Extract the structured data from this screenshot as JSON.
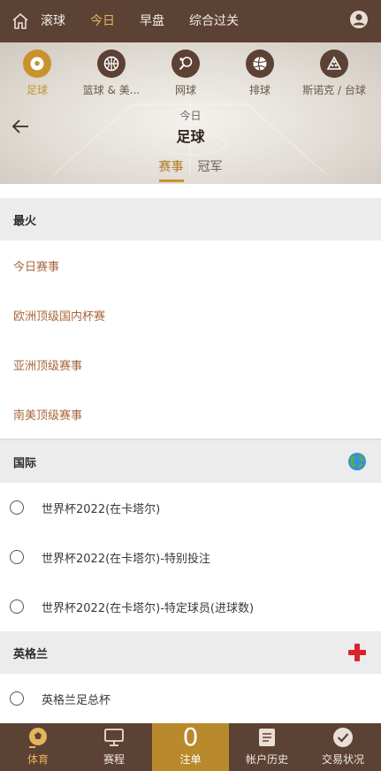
{
  "top_nav": {
    "tabs": [
      "滚球",
      "今日",
      "早盘",
      "综合过关"
    ],
    "active_tab": "今日",
    "active_color": "#e5b35a"
  },
  "sports": [
    {
      "label": "足球",
      "icon": "soccer-ball-icon",
      "active": true
    },
    {
      "label": "篮球 & 美...",
      "icon": "basketball-icon",
      "active": false
    },
    {
      "label": "网球",
      "icon": "tennis-icon",
      "active": false
    },
    {
      "label": "排球",
      "icon": "volleyball-icon",
      "active": false
    },
    {
      "label": "斯诺克 / 台球",
      "icon": "snooker-icon",
      "active": false
    }
  ],
  "header": {
    "subtitle": "今日",
    "title": "足球",
    "tabs": [
      "赛事",
      "冠军"
    ],
    "active_tab": "赛事"
  },
  "sections": {
    "hot": {
      "title": "最火",
      "items": [
        "今日赛事",
        "欧洲顶级国内杯赛",
        "亚洲顶级赛事",
        "南美顶级赛事"
      ]
    },
    "international": {
      "title": "国际",
      "flag_icon": "globe-icon",
      "items": [
        "世界杯2022(在卡塔尔)",
        "世界杯2022(在卡塔尔)-特别投注",
        "世界杯2022(在卡塔尔)-特定球员(进球数)"
      ]
    },
    "england": {
      "title": "英格兰",
      "flag_icon": "england-flag-icon",
      "items": [
        "英格兰足总杯"
      ]
    }
  },
  "bottom_nav": {
    "sports": "体育",
    "schedule": "赛程",
    "bet_count": "0",
    "bet_slip": "注单",
    "history": "帐户历史",
    "status": "交易状况"
  },
  "colors": {
    "brand_brown": "#5c4234",
    "accent_gold": "#c9922c",
    "link_brown": "#a8683c"
  }
}
